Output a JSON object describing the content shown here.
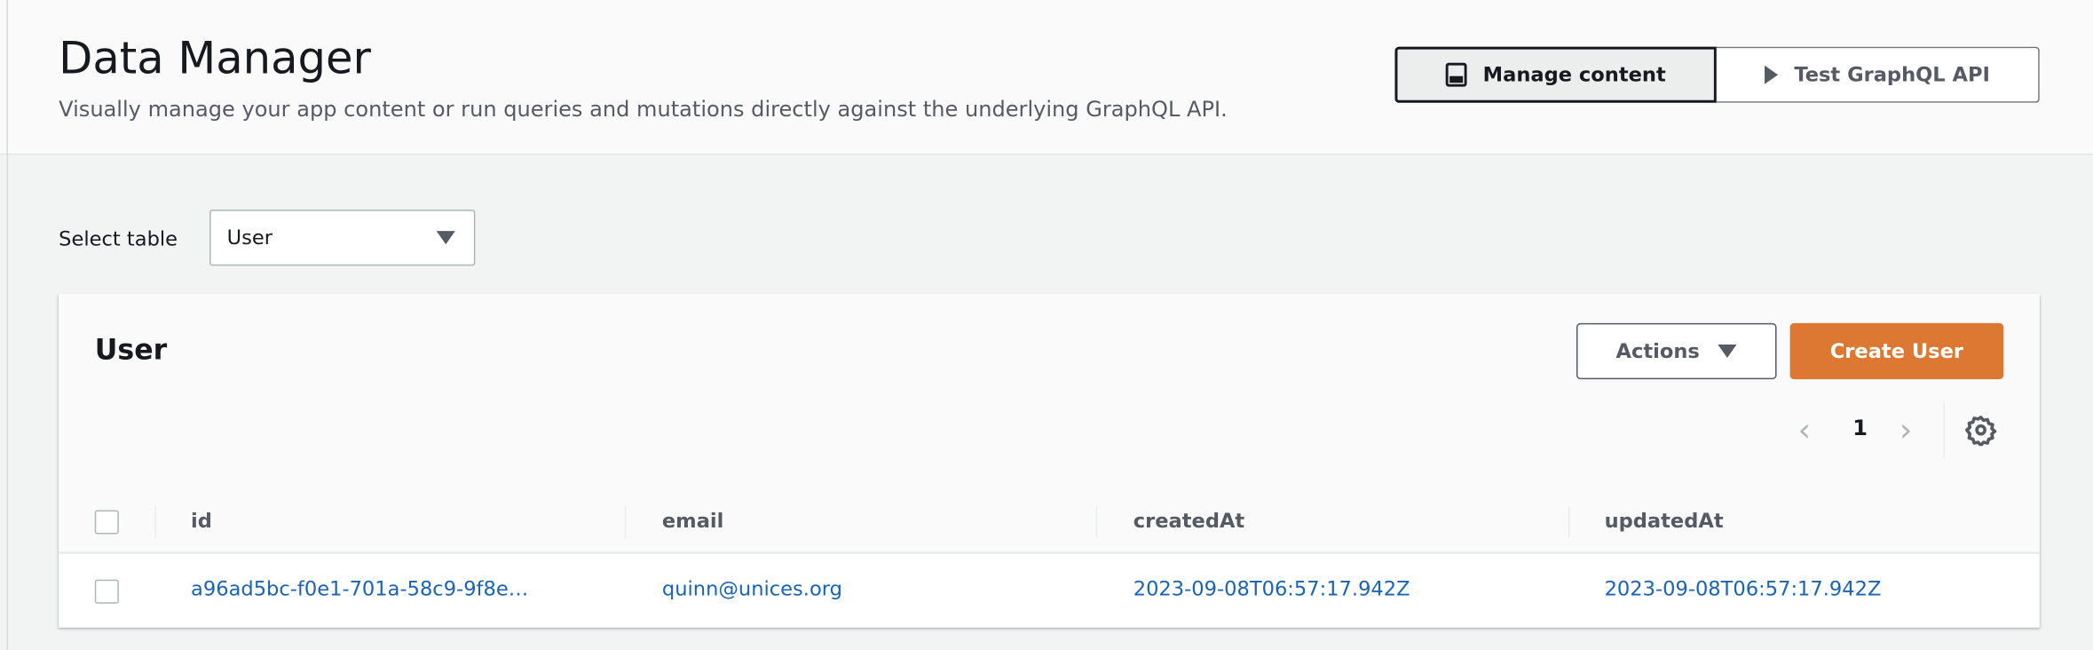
{
  "header": {
    "title": "Data Manager",
    "subtitle": "Visually manage your app content or run queries and mutations directly against the underlying GraphQL API.",
    "segments": [
      {
        "label": "Manage content",
        "icon": "content-panel-icon",
        "selected": true
      },
      {
        "label": "Test GraphQL API",
        "icon": "play-icon",
        "selected": false
      }
    ]
  },
  "table_select": {
    "label": "Select table",
    "value": "User"
  },
  "card": {
    "title": "User",
    "actions_label": "Actions",
    "create_label": "Create User",
    "create_color": "#dd7833",
    "pagination": {
      "current": "1"
    },
    "columns": [
      "id",
      "email",
      "createdAt",
      "updatedAt"
    ],
    "rows": [
      {
        "id": "a96ad5bc-f0e1-701a-58c9-9f8e…",
        "email": "quinn@unices.org",
        "createdAt": "2023-09-08T06:57:17.942Z",
        "updatedAt": "2023-09-08T06:57:17.942Z"
      }
    ]
  }
}
